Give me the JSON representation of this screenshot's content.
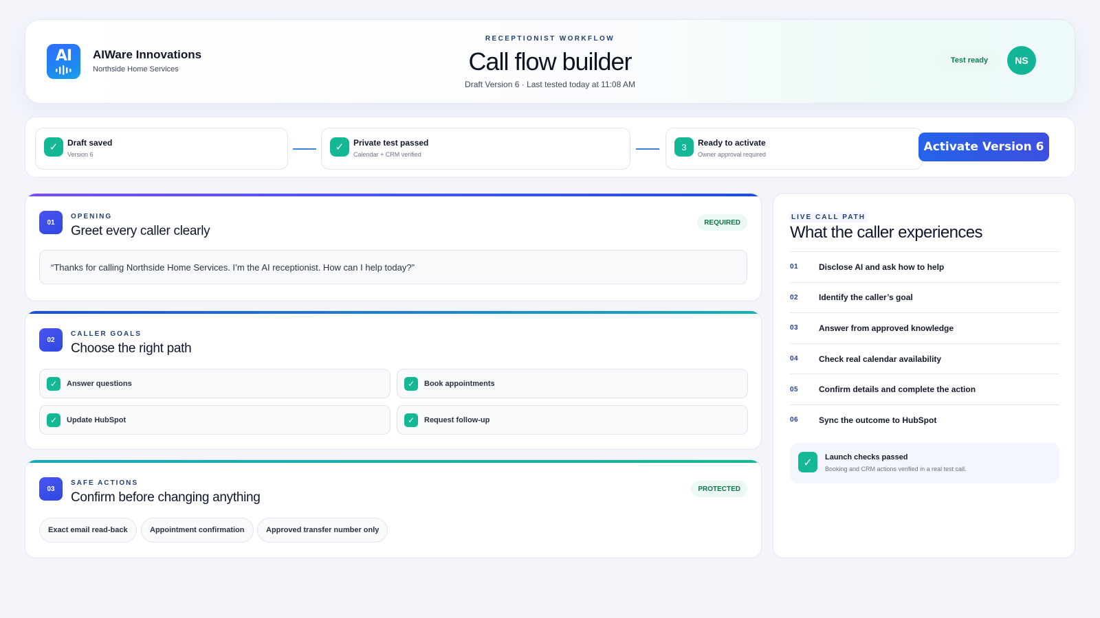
{
  "brand": {
    "logo_text": "AI",
    "name": "AIWare Innovations",
    "subtitle": "Northside Home Services"
  },
  "header": {
    "eyebrow": "RECEPTIONIST WORKFLOW",
    "title": "Call flow builder",
    "subtitle": "Draft Version 6 · Last tested today at 11:08 AM",
    "status_badge": "Test ready",
    "avatar_initials": "NS"
  },
  "steps": [
    {
      "title": "Draft saved",
      "sub": "Version 6",
      "icon": "check-icon",
      "mark": "✓"
    },
    {
      "title": "Private test passed",
      "sub": "Calendar + CRM verified",
      "icon": "check-icon",
      "mark": "✓"
    },
    {
      "title": "Ready to activate",
      "sub": "Owner approval required",
      "icon": "step-number",
      "mark": "3"
    }
  ],
  "activate_label": "Activate Version 6",
  "sections": {
    "opening": {
      "number": "01",
      "eyebrow": "OPENING",
      "title": "Greet every caller clearly",
      "tag": "REQUIRED",
      "quote": "“Thanks for calling Northside Home Services. I’m the AI receptionist. How can I help today?”"
    },
    "goals": {
      "number": "02",
      "eyebrow": "CALLER GOALS",
      "title": "Choose the right path",
      "items": [
        "Answer questions",
        "Book appointments",
        "Update HubSpot",
        "Request follow-up"
      ]
    },
    "safe": {
      "number": "03",
      "eyebrow": "SAFE ACTIONS",
      "title": "Confirm before changing anything",
      "tag": "PROTECTED",
      "pills": [
        "Exact email read-back",
        "Appointment confirmation",
        "Approved transfer number only"
      ]
    }
  },
  "live_path": {
    "eyebrow": "LIVE CALL PATH",
    "title": "What the caller experiences",
    "items": [
      {
        "num": "01",
        "label": "Disclose AI and ask how to help"
      },
      {
        "num": "02",
        "label": "Identify the caller’s goal"
      },
      {
        "num": "03",
        "label": "Answer from approved knowledge"
      },
      {
        "num": "04",
        "label": "Check real calendar availability"
      },
      {
        "num": "05",
        "label": "Confirm details and complete the action"
      },
      {
        "num": "06",
        "label": "Sync the outcome to HubSpot"
      }
    ],
    "launch": {
      "title": "Launch checks passed",
      "sub": "Booking and CRM actions verified in a real test call."
    }
  },
  "colors": {
    "accent_blue": "#2563eb",
    "success_green": "#14b894",
    "avatar_teal": "#13b497",
    "heading_navy": "#1f3e6e"
  },
  "check_mark": "✓"
}
